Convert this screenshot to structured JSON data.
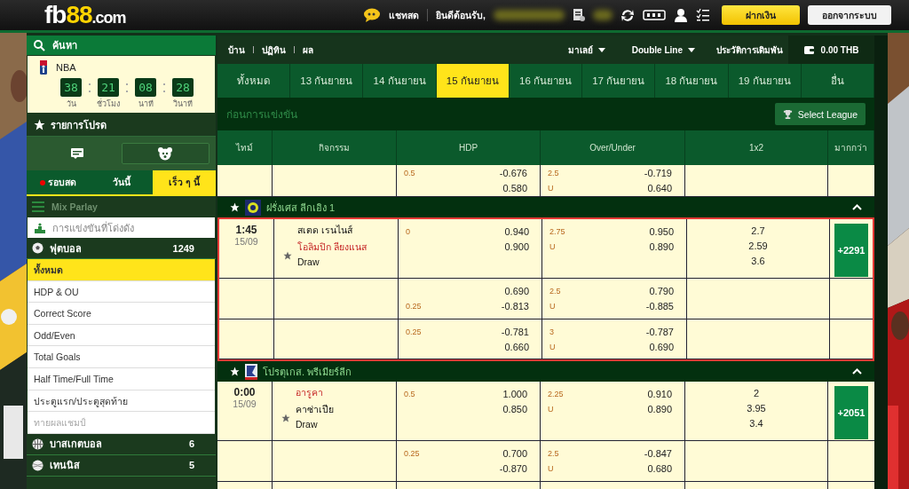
{
  "header": {
    "logo": {
      "part1": "fb",
      "part2": "88",
      "part3": ".com"
    },
    "chat_label": "แชทสด",
    "welcome": "ยินดีต้อนรับ,",
    "deposit_button": "ฝากเงิน",
    "logout_button": "ออกจากระบบ"
  },
  "sidebar": {
    "search_label": "ค้นหา",
    "countdown": {
      "league": "NBA",
      "units": [
        {
          "value": "38",
          "label": "วัน"
        },
        {
          "value": "21",
          "label": "ชั่วโมง"
        },
        {
          "value": "08",
          "label": "นาที"
        },
        {
          "value": "28",
          "label": "วินาที"
        }
      ]
    },
    "favorites_label": "รายการโปรด",
    "view_buttons": [
      {
        "kind": "message",
        "selected": false
      },
      {
        "kind": "sports",
        "selected": true
      }
    ],
    "time_tabs": [
      {
        "label": "รอบสด",
        "live": true,
        "selected": false
      },
      {
        "label": "วันนี้",
        "live": false,
        "selected": false
      },
      {
        "label": "เร็ว ๆ นี้",
        "live": false,
        "selected": true
      }
    ],
    "mix_parlay": "Mix Parlay",
    "popular": "การแข่งขันที่โด่งดัง",
    "sports": [
      {
        "kind": "football",
        "name": "ฟุตบอล",
        "count": "1249",
        "expanded": true,
        "markets": [
          {
            "label": "ทั้งหมด",
            "selected": true,
            "disabled": false
          },
          {
            "label": "HDP & OU",
            "selected": false,
            "disabled": false
          },
          {
            "label": "Correct Score",
            "selected": false,
            "disabled": false
          },
          {
            "label": "Odd/Even",
            "selected": false,
            "disabled": false
          },
          {
            "label": "Total Goals",
            "selected": false,
            "disabled": false
          },
          {
            "label": "Half Time/Full Time",
            "selected": false,
            "disabled": false
          },
          {
            "label": "ประตูแรก/ประตูสุดท้าย",
            "selected": false,
            "disabled": false
          },
          {
            "label": "ทายผลแชมป์",
            "selected": false,
            "disabled": true
          }
        ]
      },
      {
        "kind": "basketball",
        "name": "บาสเกตบอล",
        "count": "6",
        "expanded": false
      },
      {
        "kind": "tennis",
        "name": "เทนนิส",
        "count": "5",
        "expanded": false
      }
    ]
  },
  "nav": {
    "links": [
      "บ้าน",
      "ปฏิทิน",
      "ผล"
    ],
    "odds_type": "มาเลย์",
    "line_mode": "Double Line",
    "history": "ประวัติการเดิมพัน",
    "balance": "0.00 THB"
  },
  "date_tabs": [
    {
      "label": "ทั้งหมด",
      "selected": false
    },
    {
      "label": "13 กันยายน",
      "selected": false
    },
    {
      "label": "14 กันยายน",
      "selected": false
    },
    {
      "label": "15 กันยายน",
      "selected": true
    },
    {
      "label": "16 กันยายน",
      "selected": false
    },
    {
      "label": "17 กันยายน",
      "selected": false
    },
    {
      "label": "18 กันยายน",
      "selected": false
    },
    {
      "label": "19 กันยายน",
      "selected": false
    },
    {
      "label": "อื่น",
      "selected": false
    }
  ],
  "section_title": "ก่อนการแข่งขัน",
  "select_league": "Select League",
  "columns": [
    "ไทม์",
    "กิจกรรม",
    "HDP",
    "Over/Under",
    "1x2",
    "มากกว่า"
  ],
  "leading_match": {
    "lines": [
      {
        "hdp": {
          "line": "0.5",
          "line_on_away": false,
          "home": "-0.676",
          "away": "0.580"
        },
        "ou": {
          "line": "2.5",
          "under_label": "U",
          "over": "-0.719",
          "under": "0.640"
        }
      }
    ]
  },
  "leagues": [
    {
      "name": "ฝรั่งเศส ลีกเอิง 1",
      "kind": "france",
      "matches": [
        {
          "time": "1:45",
          "date": "15/09",
          "highlighted": true,
          "teams": [
            {
              "name": "สเตด เรนไนส์",
              "favored": false
            },
            {
              "name": "โอลิมปิก ลียงแนส",
              "favored": true
            }
          ],
          "draw": "Draw",
          "x12": [
            "2.7",
            "2.59",
            "3.6"
          ],
          "more": "+2291",
          "lines": [
            {
              "hdp": {
                "line": "0",
                "line_on_away": false,
                "home": "0.940",
                "away": "0.900"
              },
              "ou": {
                "line": "2.75",
                "under_label": "U",
                "over": "0.950",
                "under": "0.890"
              }
            },
            {
              "hdp": {
                "line": "0.25",
                "line_on_away": true,
                "home": "0.690",
                "away": "-0.813"
              },
              "ou": {
                "line": "2.5",
                "under_label": "U",
                "over": "0.790",
                "under": "-0.885"
              }
            },
            {
              "hdp": {
                "line": "0.25",
                "line_on_away": false,
                "home": "-0.781",
                "away": "0.660"
              },
              "ou": {
                "line": "3",
                "under_label": "U",
                "over": "-0.787",
                "under": "0.690"
              }
            }
          ]
        }
      ]
    },
    {
      "name": "โปรตุเกส. พรีเมียร์ลีก",
      "kind": "portugal",
      "matches": [
        {
          "time": "0:00",
          "date": "15/09",
          "highlighted": false,
          "teams": [
            {
              "name": "อารูคา",
              "favored": true
            },
            {
              "name": "คาซ่าเปีย",
              "favored": false
            }
          ],
          "draw": "Draw",
          "x12": [
            "2",
            "3.95",
            "3.4"
          ],
          "more": "+2051",
          "lines": [
            {
              "hdp": {
                "line": "0.5",
                "line_on_away": false,
                "home": "1.000",
                "away": "0.850"
              },
              "ou": {
                "line": "2.25",
                "under_label": "U",
                "over": "0.910",
                "under": "0.890"
              }
            },
            {
              "hdp": {
                "line": "0.25",
                "line_on_away": false,
                "home": "0.700",
                "away": "-0.870"
              },
              "ou": {
                "line": "2.5",
                "under_label": "U",
                "over": "-0.847",
                "under": "0.680"
              }
            }
          ]
        }
      ]
    }
  ]
}
